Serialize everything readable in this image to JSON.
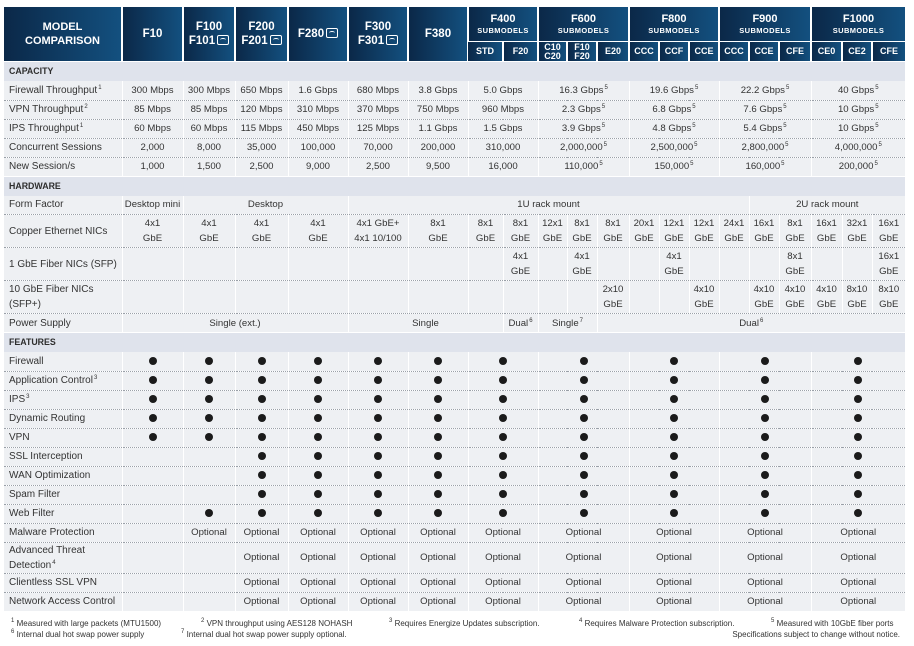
{
  "colors": {
    "header_dark": "#0b2848",
    "header_light": "#13507f",
    "section_bg": "#dfe3ec",
    "row_bg": "#eef0f3"
  },
  "header": {
    "title": "MODEL\nCOMPARISON",
    "submodels_label": "SUBMODELS",
    "models": [
      {
        "lines": [
          "F10"
        ],
        "wifi": false
      },
      {
        "lines": [
          "F100",
          "F101"
        ],
        "wifi": true
      },
      {
        "lines": [
          "F200",
          "F201"
        ],
        "wifi": true
      },
      {
        "lines": [
          "F280"
        ],
        "wifi": true
      },
      {
        "lines": [
          "F300",
          "F301"
        ],
        "wifi": true
      },
      {
        "lines": [
          "F380"
        ],
        "wifi": false
      },
      {
        "lines": [
          "F400"
        ],
        "subs": [
          "STD",
          "F20"
        ]
      },
      {
        "lines": [
          "F600"
        ],
        "subs": [
          "C10\nC20",
          "F10\nF20",
          "E20"
        ]
      },
      {
        "lines": [
          "F800"
        ],
        "subs": [
          "CCC",
          "CCF",
          "CCE"
        ]
      },
      {
        "lines": [
          "F900"
        ],
        "subs": [
          "CCC",
          "CCE",
          "CFE"
        ]
      },
      {
        "lines": [
          "F1000"
        ],
        "subs": [
          "CE0",
          "CE2",
          "CFE"
        ]
      }
    ]
  },
  "sections": [
    {
      "title": "CAPACITY",
      "rows": [
        {
          "label": "Firewall Throughput",
          "sup": "1",
          "cells": [
            {
              "t": "300 Mbps"
            },
            {
              "t": "300 Mbps"
            },
            {
              "t": "650 Mbps"
            },
            {
              "t": "1.6 Gbps"
            },
            {
              "t": "680 Mbps"
            },
            {
              "t": "3.8 Gbps"
            },
            {
              "t": "5.0 Gbps",
              "span": 2
            },
            {
              "t": "16.3 Gbps",
              "sup": "5",
              "span": 3
            },
            {
              "t": "19.6 Gbps",
              "sup": "5",
              "span": 3
            },
            {
              "t": "22.2 Gbps",
              "sup": "5",
              "span": 3
            },
            {
              "t": "40 Gbps",
              "sup": "5",
              "span": 3
            }
          ]
        },
        {
          "label": "VPN Throughput",
          "sup": "2",
          "cells": [
            {
              "t": "85 Mbps"
            },
            {
              "t": "85 Mbps"
            },
            {
              "t": "120 Mbps"
            },
            {
              "t": "310 Mbps"
            },
            {
              "t": "370 Mbps"
            },
            {
              "t": "750 Mbps"
            },
            {
              "t": "960 Mbps",
              "span": 2
            },
            {
              "t": "2.3 Gbps",
              "sup": "5",
              "span": 3
            },
            {
              "t": "6.8 Gbps",
              "sup": "5",
              "span": 3
            },
            {
              "t": "7.6 Gbps",
              "sup": "5",
              "span": 3
            },
            {
              "t": "10 Gbps",
              "sup": "5",
              "span": 3
            }
          ]
        },
        {
          "label": "IPS Throughput",
          "sup": "1",
          "cells": [
            {
              "t": "60 Mbps"
            },
            {
              "t": "60 Mbps"
            },
            {
              "t": "115 Mbps"
            },
            {
              "t": "450 Mbps"
            },
            {
              "t": "125 Mbps"
            },
            {
              "t": "1.1 Gbps"
            },
            {
              "t": "1.5 Gbps",
              "span": 2
            },
            {
              "t": "3.9 Gbps",
              "sup": "5",
              "span": 3
            },
            {
              "t": "4.8 Gbps",
              "sup": "5",
              "span": 3
            },
            {
              "t": "5.4 Gbps",
              "sup": "5",
              "span": 3
            },
            {
              "t": "10 Gbps",
              "sup": "5",
              "span": 3
            }
          ]
        },
        {
          "label": "Concurrent Sessions",
          "cells": [
            {
              "t": "2,000"
            },
            {
              "t": "8,000"
            },
            {
              "t": "35,000"
            },
            {
              "t": "100,000"
            },
            {
              "t": "70,000"
            },
            {
              "t": "200,000"
            },
            {
              "t": "310,000",
              "span": 2
            },
            {
              "t": "2,000,000",
              "sup": "5",
              "span": 3
            },
            {
              "t": "2,500,000",
              "sup": "5",
              "span": 3
            },
            {
              "t": "2,800,000",
              "sup": "5",
              "span": 3
            },
            {
              "t": "4,000,000",
              "sup": "5",
              "span": 3
            }
          ]
        },
        {
          "label": "New Session/s",
          "cells": [
            {
              "t": "1,000"
            },
            {
              "t": "1,500"
            },
            {
              "t": "2,500"
            },
            {
              "t": "9,000"
            },
            {
              "t": "2,500"
            },
            {
              "t": "9,500"
            },
            {
              "t": "16,000",
              "span": 2
            },
            {
              "t": "110,000",
              "sup": "5",
              "span": 3
            },
            {
              "t": "150,000",
              "sup": "5",
              "span": 3
            },
            {
              "t": "160,000",
              "sup": "5",
              "span": 3
            },
            {
              "t": "200,000",
              "sup": "5",
              "span": 3
            }
          ]
        }
      ]
    },
    {
      "title": "HARDWARE",
      "rows": [
        {
          "label": "Form Factor",
          "cells": [
            {
              "t": "Desktop mini"
            },
            {
              "t": "Desktop",
              "span": 3
            },
            {
              "t": "1U rack mount",
              "span": 11
            },
            {
              "t": "2U rack mount",
              "span": 6
            }
          ]
        },
        {
          "label": "Copper Ethernet NICs",
          "tall": true,
          "cells": [
            {
              "t": "4x1\nGbE"
            },
            {
              "t": "4x1\nGbE"
            },
            {
              "t": "4x1\nGbE"
            },
            {
              "t": "4x1\nGbE"
            },
            {
              "t": "4x1 GbE+\n4x1 10/100"
            },
            {
              "t": "8x1\nGbE"
            },
            {
              "t": "8x1\nGbE"
            },
            {
              "t": "8x1\nGbE"
            },
            {
              "t": "12x1\nGbE"
            },
            {
              "t": "8x1\nGbE"
            },
            {
              "t": "8x1\nGbE"
            },
            {
              "t": "20x1\nGbE"
            },
            {
              "t": "12x1\nGbE"
            },
            {
              "t": "12x1\nGbE"
            },
            {
              "t": "24x1\nGbE"
            },
            {
              "t": "16x1\nGbE"
            },
            {
              "t": "8x1\nGbE"
            },
            {
              "t": "16x1\nGbE"
            },
            {
              "t": "32x1\nGbE"
            },
            {
              "t": "16x1\nGbE"
            }
          ]
        },
        {
          "label": "1 GbE Fiber NICs (SFP)",
          "tall": true,
          "cells": [
            {
              "t": ""
            },
            {
              "t": ""
            },
            {
              "t": ""
            },
            {
              "t": ""
            },
            {
              "t": ""
            },
            {
              "t": ""
            },
            {
              "t": ""
            },
            {
              "t": "4x1\nGbE"
            },
            {
              "t": ""
            },
            {
              "t": "4x1\nGbE"
            },
            {
              "t": ""
            },
            {
              "t": ""
            },
            {
              "t": "4x1\nGbE"
            },
            {
              "t": ""
            },
            {
              "t": ""
            },
            {
              "t": ""
            },
            {
              "t": "8x1\nGbE"
            },
            {
              "t": ""
            },
            {
              "t": ""
            },
            {
              "t": "16x1\nGbE"
            }
          ]
        },
        {
          "label": "10 GbE Fiber NICs (SFP+)",
          "tall": true,
          "cells": [
            {
              "t": ""
            },
            {
              "t": ""
            },
            {
              "t": ""
            },
            {
              "t": ""
            },
            {
              "t": ""
            },
            {
              "t": ""
            },
            {
              "t": ""
            },
            {
              "t": ""
            },
            {
              "t": ""
            },
            {
              "t": ""
            },
            {
              "t": "2x10\nGbE"
            },
            {
              "t": ""
            },
            {
              "t": ""
            },
            {
              "t": "4x10\nGbE"
            },
            {
              "t": ""
            },
            {
              "t": "4x10\nGbE"
            },
            {
              "t": "4x10\nGbE"
            },
            {
              "t": "4x10\nGbE"
            },
            {
              "t": "8x10\nGbE"
            },
            {
              "t": "8x10\nGbE"
            }
          ]
        },
        {
          "label": "Power Supply",
          "cells": [
            {
              "t": "Single (ext.)",
              "span": 4
            },
            {
              "t": "Single",
              "span": 3
            },
            {
              "t": "Dual",
              "sup": "6"
            },
            {
              "t": "Single",
              "sup": "7",
              "span": 2
            },
            {
              "t": "Dual",
              "sup": "6",
              "span": 10
            }
          ]
        }
      ]
    },
    {
      "title": "FEATURES",
      "rows": [
        {
          "label": "Firewall",
          "cells": [
            "dot",
            "dot",
            "dot",
            "dot",
            "dot",
            "dot",
            "dot",
            "dot",
            "dot",
            "dot",
            "dot"
          ]
        },
        {
          "label": "Application Control",
          "sup": "3",
          "cells": [
            "dot",
            "dot",
            "dot",
            "dot",
            "dot",
            "dot",
            "dot",
            "dot",
            "dot",
            "dot",
            "dot"
          ]
        },
        {
          "label": "IPS",
          "sup": "3",
          "cells": [
            "dot",
            "dot",
            "dot",
            "dot",
            "dot",
            "dot",
            "dot",
            "dot",
            "dot",
            "dot",
            "dot"
          ]
        },
        {
          "label": "Dynamic Routing",
          "cells": [
            "dot",
            "dot",
            "dot",
            "dot",
            "dot",
            "dot",
            "dot",
            "dot",
            "dot",
            "dot",
            "dot"
          ]
        },
        {
          "label": "VPN",
          "cells": [
            "dot",
            "dot",
            "dot",
            "dot",
            "dot",
            "dot",
            "dot",
            "dot",
            "dot",
            "dot",
            "dot"
          ]
        },
        {
          "label": "SSL Interception",
          "cells": [
            "",
            "",
            "dot",
            "dot",
            "dot",
            "dot",
            "dot",
            "dot",
            "dot",
            "dot",
            "dot"
          ]
        },
        {
          "label": "WAN Optimization",
          "cells": [
            "",
            "",
            "dot",
            "dot",
            "dot",
            "dot",
            "dot",
            "dot",
            "dot",
            "dot",
            "dot"
          ]
        },
        {
          "label": "Spam Filter",
          "cells": [
            "",
            "",
            "dot",
            "dot",
            "dot",
            "dot",
            "dot",
            "dot",
            "dot",
            "dot",
            "dot"
          ]
        },
        {
          "label": "Web Filter",
          "cells": [
            "",
            "dot",
            "dot",
            "dot",
            "dot",
            "dot",
            "dot",
            "dot",
            "dot",
            "dot",
            "dot"
          ]
        },
        {
          "label": "Malware Protection",
          "cells": [
            "",
            "Optional",
            "Optional",
            "Optional",
            "Optional",
            "Optional",
            "Optional",
            "Optional",
            "Optional",
            "Optional",
            "Optional"
          ]
        },
        {
          "label": "Advanced Threat\nDetection",
          "sup": "4",
          "tall": true,
          "cells": [
            "",
            "",
            "Optional",
            "Optional",
            "Optional",
            "Optional",
            "Optional",
            "Optional",
            "Optional",
            "Optional",
            "Optional"
          ]
        },
        {
          "label": "Clientless SSL VPN",
          "cells": [
            "",
            "",
            "Optional",
            "Optional",
            "Optional",
            "Optional",
            "Optional",
            "Optional",
            "Optional",
            "Optional",
            "Optional"
          ]
        },
        {
          "label": "Network Access Control",
          "cells": [
            "",
            "",
            "Optional",
            "Optional",
            "Optional",
            "Optional",
            "Optional",
            "Optional",
            "Optional",
            "Optional",
            "Optional"
          ]
        }
      ]
    }
  ],
  "footnotes": [
    {
      "n": "1",
      "t": "Measured with large packets (MTU1500)"
    },
    {
      "n": "2",
      "t": "VPN throughput using AES128 NOHASH"
    },
    {
      "n": "3",
      "t": "Requires Energize Updates subscription."
    },
    {
      "n": "4",
      "t": "Requires Malware Protection subscription."
    },
    {
      "n": "5",
      "t": "Measured with 10GbE fiber ports"
    },
    {
      "n": "6",
      "t": "Internal dual hot swap power supply"
    },
    {
      "n": "7",
      "t": "Internal dual hot swap power supply optional."
    }
  ],
  "disclaimer": "Specifications subject to change without notice."
}
